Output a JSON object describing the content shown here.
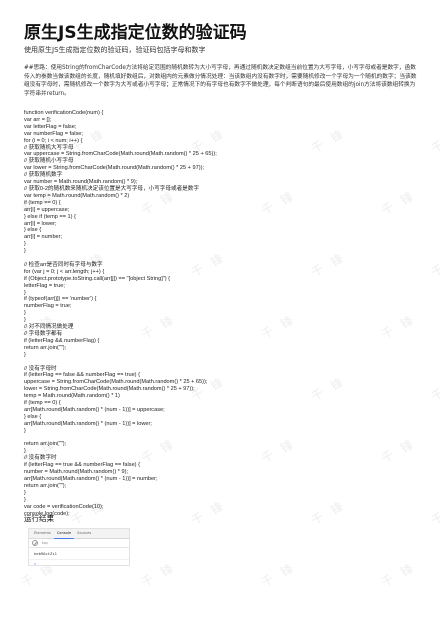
{
  "watermark": "千 锋",
  "title": "原生JS生成指定位数的验证码",
  "subtitle": "使用原生JS生成指定位数的验证码，验证码包括字母和数字",
  "intro": "##思路：使用String的fromCharCode方法将给定范围的随机数转为大小写字母，再通过随机数决定数组当前位置为大写字母，小写字母或者是数字，函数传入的参数当做该数组的长度，随机填好数组后，对数组内的元素做分情况处理：当该数组内没有数字时，需要随机修改一个字母为一个随机的数字；当该数组没有字母时，需随机修改一个数字为大写或者小写字母；正常情况下的有字母也有数字不做处理，每个判断语句的最后使用数组的join方法将该数组转换为字符串并return。",
  "code_lines": [
    "function verificationCode(num) {",
    "var arr = [];",
    "var letterFlag = false;",
    "var numberFlag = false;",
    "for (i = 0; i < num; i++) {",
    "// 获取随机大写字母",
    "var uppercase = String.fromCharCode(Math.round(Math.random() * 25 + 65));",
    "// 获取随机小写字母",
    "var lower = String.fromCharCode(Math.round(Math.random() * 25 + 97));",
    "// 获取随机数字",
    "var number = Math.round(Math.random() * 9);",
    "// 获取0-2的随机数来随机决定该位置是大写字母，小写字母或者是数字",
    "var temp = Math.round(Math.random() * 2)",
    "if (temp == 0) {",
    "arr[i] = uppercase;",
    "} else if (temp == 1) {",
    "arr[i] = lower;",
    "} else {",
    "arr[i] = number;",
    "}",
    "}",
    "",
    "// 检查arr是否同时有字母与数字",
    "for (var j = 0; j < arr.length; j++) {",
    "if (Object.prototype.toString.call(arr[j]) == \"[object String]\") {",
    "letterFlag = true;",
    "}",
    "if (typeof(arr[j]) == 'number') {",
    "numberFlag = true;",
    "}",
    "}",
    "// 对不同情况做处理",
    "// 字母数字都有",
    "if (letterFlag && numberFlag) {",
    "return arr.join(\"\");",
    "}",
    "",
    "// 没有字母时",
    "if (letterFlag == false && numberFlag == true) {",
    "uppercase = String.fromCharCode(Math.round(Math.random() * 25 + 65));",
    "lower = String.fromCharCode(Math.round(Math.random() * 25 + 97));",
    "temp = Math.round(Math.random() * 1)",
    "if (temp == 0) {",
    "arr[Math.round(Math.random() * (num - 1))] = uppercase;",
    "} else {",
    "arr[Math.round(Math.random() * (num - 1))] = lower;",
    "}",
    "",
    "return arr.join(\"\");",
    "}",
    "// 没有数字时",
    "if (letterFlag == true && numberFlag == false) {",
    "number = Math.round(Math.random() * 9);",
    "arr[Math.round(Math.random() * (num - 1))] = number;",
    "return arr.join(\"\");",
    "}",
    "}",
    "var code = verificationCode(10);",
    "console.log(code);"
  ],
  "result_heading": "运行结果",
  "console": {
    "tabs": [
      "Elements",
      "Console",
      "Sources"
    ],
    "active_tab": "Console",
    "filter_placeholder": "top",
    "output": "keb9OctZi1",
    "prompt": ">"
  }
}
